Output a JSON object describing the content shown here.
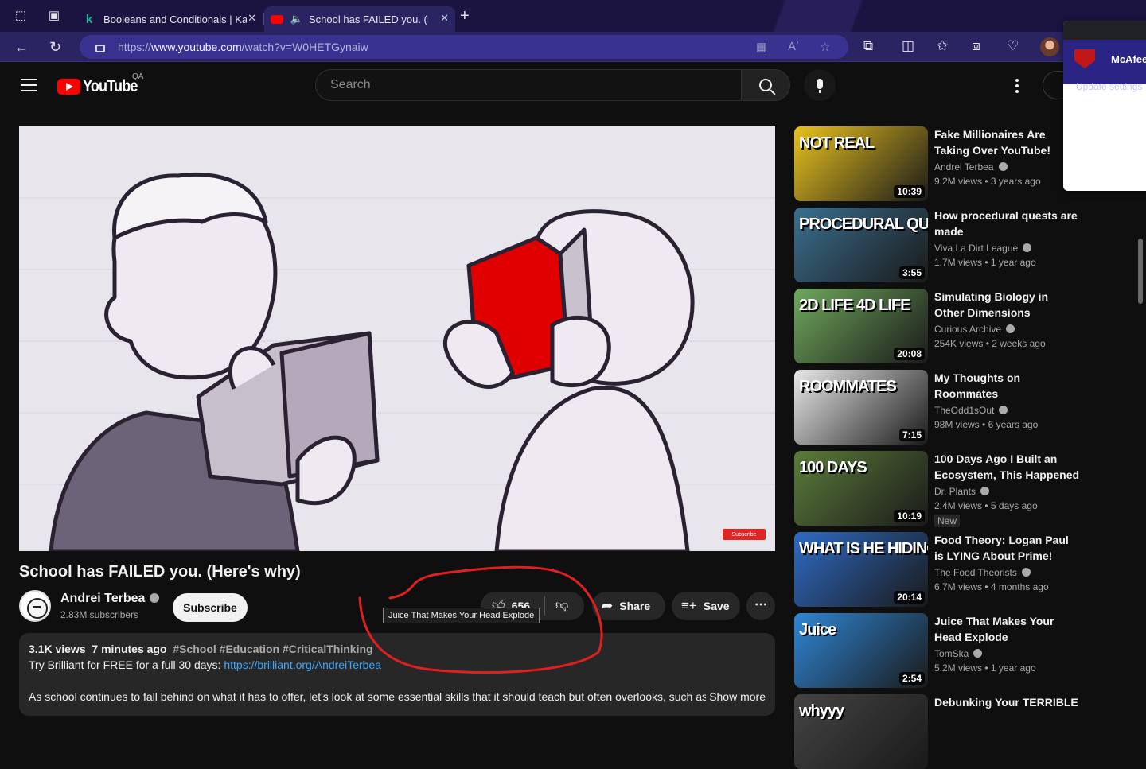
{
  "browser": {
    "tabs": [
      {
        "title": "Booleans and Conditionals | Ka",
        "favicon": "khan-academy-icon"
      },
      {
        "title": "School has FAILED you. (H",
        "favicon": "youtube-icon",
        "active": true
      }
    ],
    "url_prefix": "https://",
    "url_host": "www.youtube.com",
    "url_path": "/watch?v=W0HETGynaiw"
  },
  "mcafee": {
    "name": "McAfee",
    "subtitle": "Update settings"
  },
  "youtube": {
    "logo_text": "YouTube",
    "country_code": "QA",
    "search_placeholder": "Search"
  },
  "video": {
    "title": "School has FAILED you. (Here's why)",
    "channel": "Andrei Terbea",
    "subscribers": "2.83M subscribers",
    "subscribe_label": "Subscribe",
    "likes": "656",
    "share_label": "Share",
    "save_label": "Save",
    "watermark": "Subscribe",
    "tooltip": "Juice That Makes Your Head Explode",
    "views": "3.1K views",
    "age": "7 minutes ago",
    "tags": "#School #Education #CriticalThinking",
    "desc_line1_prefix": "Try Brilliant for FREE for a full 30 days: ",
    "desc_link": "https://brilliant.org/AndreiTerbea",
    "desc_line3": "As school continues to fall behind on what it has to offer, let's look at some essential skills that it should teach but often overlooks, such as",
    "show_more": "Show more"
  },
  "recommendations": [
    {
      "title": "Fake Millionaires Are Taking Over YouTube!",
      "channel": "Andrei Terbea",
      "views": "9.2M views",
      "age": "3 years ago",
      "duration": "10:39",
      "thumb_text": "NOT REAL",
      "bg": "#e9c21e"
    },
    {
      "title": "How procedural quests are made",
      "channel": "Viva La Dirt League",
      "views": "1.7M views",
      "age": "1 year ago",
      "duration": "3:55",
      "thumb_text": "PROCEDURAL QUESTS",
      "bg": "#3a6f8f"
    },
    {
      "title": "Simulating Biology in Other Dimensions",
      "channel": "Curious Archive",
      "views": "254K views",
      "age": "2 weeks ago",
      "duration": "20:08",
      "thumb_text": "2D LIFE   4D LIFE",
      "bg": "#6fa85c"
    },
    {
      "title": "My Thoughts on Roommates",
      "channel": "TheOdd1sOut",
      "views": "98M views",
      "age": "6 years ago",
      "duration": "7:15",
      "thumb_text": "ROOMMATES",
      "bg": "#e8e8e8"
    },
    {
      "title": "100 Days Ago I Built an Ecosystem, This Happened",
      "channel": "Dr. Plants",
      "views": "2.4M views",
      "age": "5 days ago",
      "duration": "10:19",
      "thumb_text": "100 DAYS",
      "bg": "#5b7c3a",
      "badge": "New"
    },
    {
      "title": "Food Theory: Logan Paul is LYING About Prime!",
      "channel": "The Food Theorists",
      "views": "6.7M views",
      "age": "4 months ago",
      "duration": "20:14",
      "thumb_text": "WHAT IS HE HIDING?",
      "bg": "#2e6bc4"
    },
    {
      "title": "Juice That Makes Your Head Explode",
      "channel": "TomSka",
      "views": "5.2M views",
      "age": "1 year ago",
      "duration": "2:54",
      "thumb_text": "Juice",
      "bg": "#2f86d6"
    },
    {
      "title": "Debunking Your TERRIBLE",
      "channel": "",
      "views": "",
      "age": "",
      "duration": "",
      "thumb_text": "whyyy",
      "bg": "#444444"
    }
  ]
}
